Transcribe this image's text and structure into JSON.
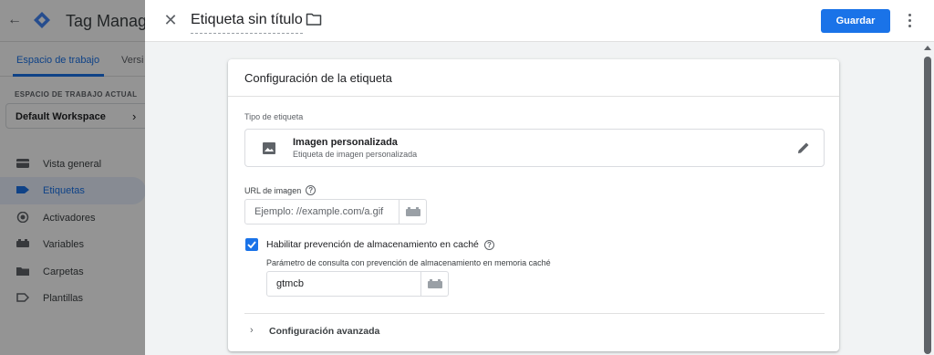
{
  "app": {
    "name": "Tag Manager"
  },
  "background": {
    "tabs": [
      {
        "label": "Espacio de trabajo",
        "active": true
      },
      {
        "label": "Versi",
        "active": false
      }
    ],
    "workspace_section_label": "ESPACIO DE TRABAJO ACTUAL",
    "workspace_name": "Default Workspace",
    "nav": [
      {
        "label": "Vista general",
        "icon": "overview-icon",
        "active": false
      },
      {
        "label": "Etiquetas",
        "icon": "tag-icon",
        "active": true
      },
      {
        "label": "Activadores",
        "icon": "trigger-icon",
        "active": false
      },
      {
        "label": "Variables",
        "icon": "variables-icon",
        "active": false
      },
      {
        "label": "Carpetas",
        "icon": "folder-icon",
        "active": false
      },
      {
        "label": "Plantillas",
        "icon": "template-icon",
        "active": false
      }
    ]
  },
  "editor": {
    "tag_name": "Etiqueta sin título",
    "save_label": "Guardar",
    "card_title": "Configuración de la etiqueta",
    "tag_type_label": "Tipo de etiqueta",
    "tag_type": {
      "name": "Imagen personalizada",
      "description": "Etiqueta de imagen personalizada",
      "icon": "image-icon"
    },
    "image_url": {
      "label": "URL de imagen",
      "placeholder": "Ejemplo: //example.com/a.gif",
      "value": ""
    },
    "cache_busting": {
      "checked": true,
      "label": "Habilitar prevención de almacenamiento en caché",
      "param_label": "Parámetro de consulta con prevención de almacenamiento en memoria caché",
      "param_value": "gtmcb"
    },
    "advanced_label": "Configuración avanzada"
  },
  "colors": {
    "accent": "#1a73e8",
    "scrim": "rgba(0,0,0,0.42)"
  }
}
